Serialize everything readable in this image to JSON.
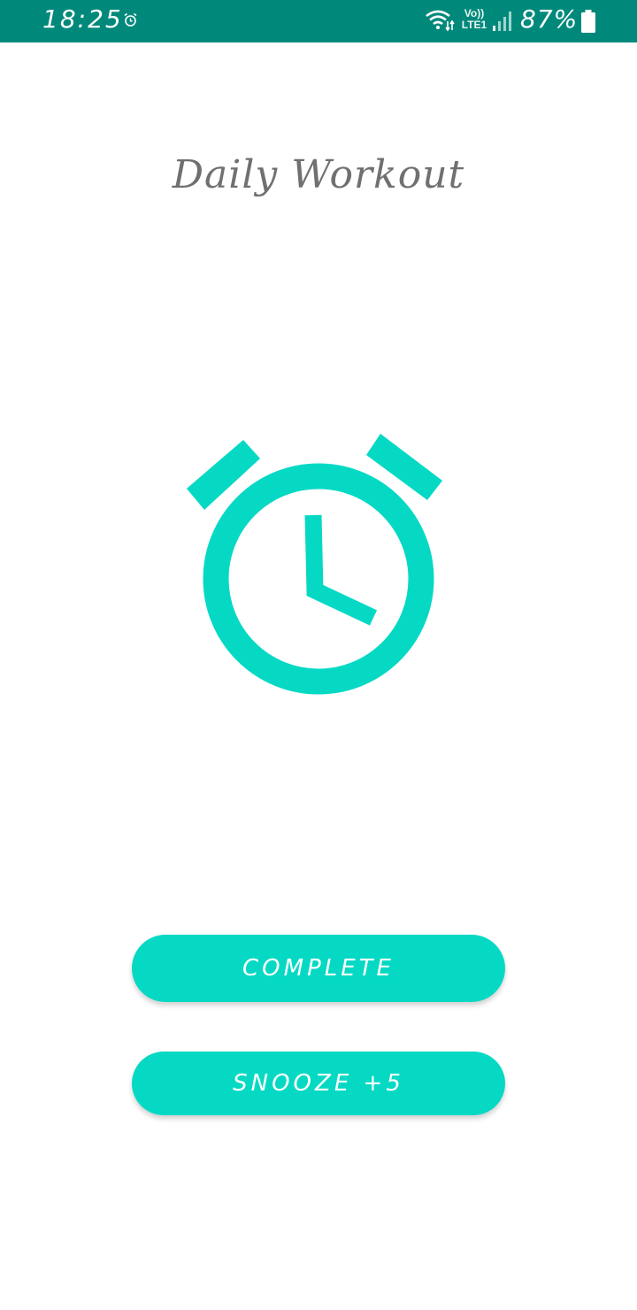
{
  "status_bar": {
    "time": "18:25",
    "network_top": "Vo))",
    "network_bottom": "LTE1",
    "battery_percent": "87%",
    "icons": [
      "alarm-icon",
      "wifi-icon",
      "signal-icon",
      "battery-icon"
    ]
  },
  "screen": {
    "title": "Daily Workout",
    "icon": "alarm-clock-icon"
  },
  "buttons": {
    "complete_label": "COMPLETE",
    "snooze_label": "SNOOZE +5"
  },
  "colors": {
    "status_bar": "#00897b",
    "accent": "#05d9c4",
    "title_text": "#707070",
    "background": "#ffffff"
  }
}
